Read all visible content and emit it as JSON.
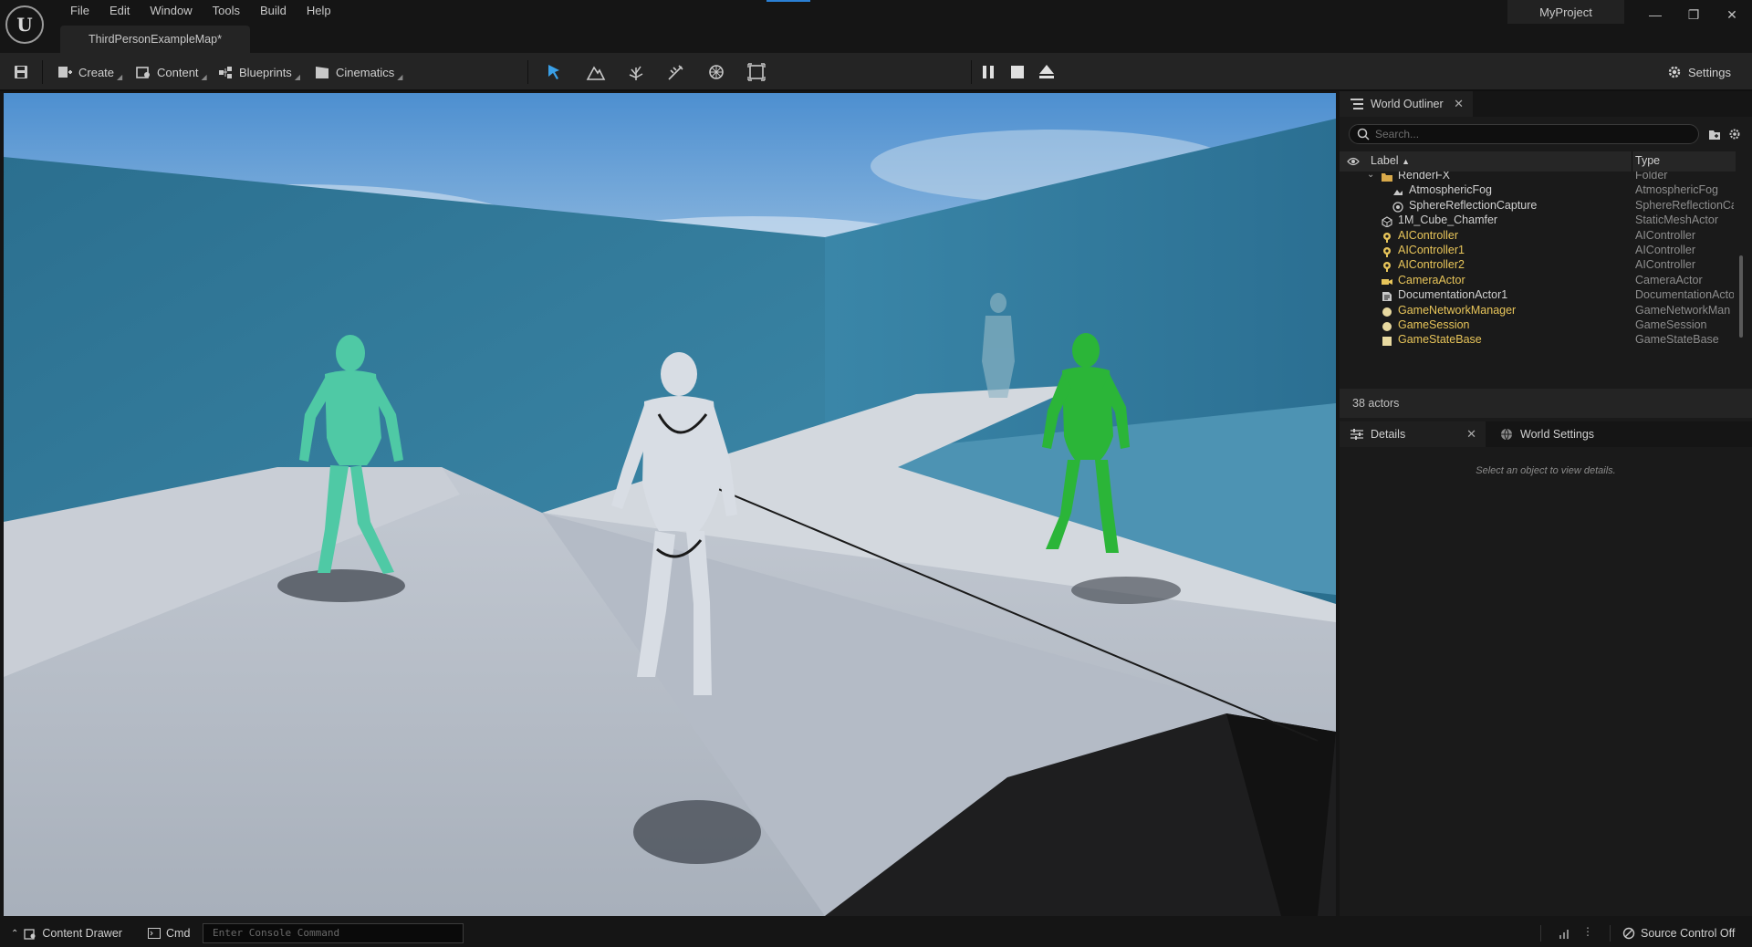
{
  "menu": [
    "File",
    "Edit",
    "Window",
    "Tools",
    "Build",
    "Help"
  ],
  "map_tab": "ThirdPersonExampleMap*",
  "project_name": "MyProject",
  "window_controls": {
    "minimize": "—",
    "restore": "❐",
    "close": "✕"
  },
  "toolbar": {
    "create": "Create",
    "content": "Content",
    "blueprints": "Blueprints",
    "cinematics": "Cinematics",
    "settings": "Settings"
  },
  "outliner": {
    "tab_title": "World Outliner",
    "search_placeholder": "Search...",
    "col_label": "Label",
    "col_type": "Type",
    "rows": [
      {
        "label": "RenderFX",
        "type": "Folder",
        "indent": 1,
        "icon": "folder"
      },
      {
        "label": "AtmosphericFog",
        "type": "AtmosphericFog",
        "indent": 2,
        "icon": "fog"
      },
      {
        "label": "SphereReflectionCapture",
        "type": "SphereReflectionCa",
        "indent": 2,
        "icon": "sphere"
      },
      {
        "label": "1M_Cube_Chamfer",
        "type": "StaticMeshActor",
        "indent": 0,
        "icon": "mesh"
      },
      {
        "label": "AIController",
        "type": "AIController",
        "indent": 0,
        "icon": "controller"
      },
      {
        "label": "AIController1",
        "type": "AIController",
        "indent": 0,
        "icon": "controller"
      },
      {
        "label": "AIController2",
        "type": "AIController",
        "indent": 0,
        "icon": "controller"
      },
      {
        "label": "CameraActor",
        "type": "CameraActor",
        "indent": 0,
        "icon": "camera"
      },
      {
        "label": "DocumentationActor1",
        "type": "DocumentationActo",
        "indent": 0,
        "icon": "doc"
      },
      {
        "label": "GameNetworkManager",
        "type": "GameNetworkMan",
        "indent": 0,
        "icon": "circle"
      },
      {
        "label": "GameSession",
        "type": "GameSession",
        "indent": 0,
        "icon": "circle"
      },
      {
        "label": "GameStateBase",
        "type": "GameStateBase",
        "indent": 0,
        "icon": "square"
      }
    ],
    "actor_count": "38 actors"
  },
  "details": {
    "tab_title": "Details",
    "world_settings_tab": "World Settings",
    "hint": "Select an object to view details."
  },
  "statusbar": {
    "content_drawer": "Content Drawer",
    "cmd": "Cmd",
    "console_placeholder": "Enter Console Command",
    "source_control": "Source Control Off"
  },
  "colors": {
    "accent": "#2a7fd4",
    "actor_text": "#e8c55a",
    "selected_tool": "#3aa0e8"
  }
}
